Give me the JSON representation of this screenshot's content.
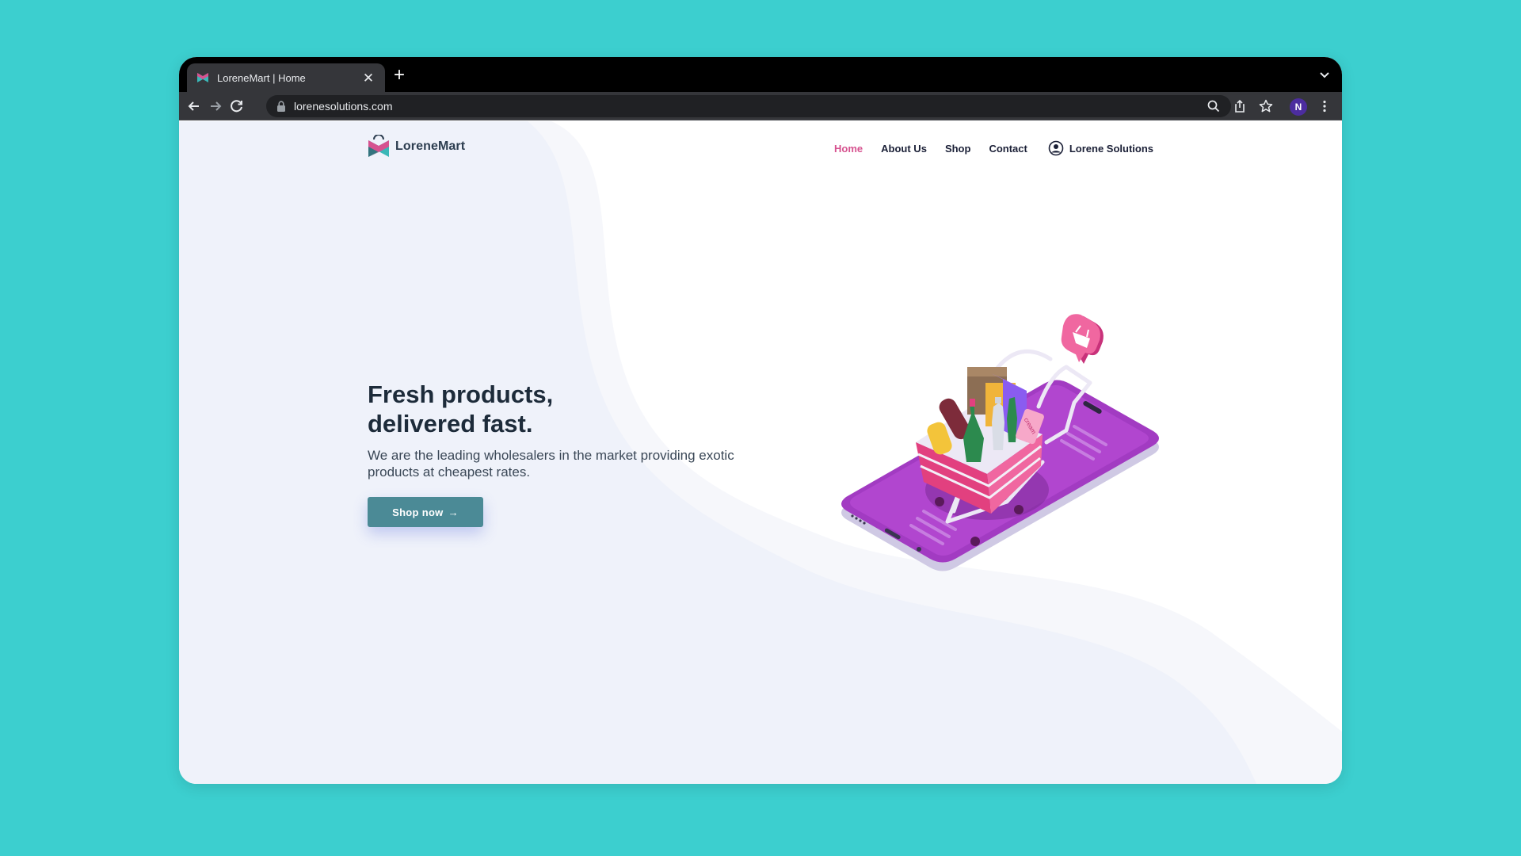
{
  "browser": {
    "tab_title": "LoreneMart | Home",
    "tab_close": "✕",
    "new_tab": "+",
    "url": "lorenesolutions.com",
    "profile_initial": "N",
    "profile_color": "#4c2d9f"
  },
  "site": {
    "logo_text": "LoreneMart",
    "nav": {
      "home": "Home",
      "about": "About Us",
      "shop": "Shop",
      "contact": "Contact",
      "account": "Lorene Solutions"
    },
    "active_nav": "home",
    "accent_color": "#d6528f"
  },
  "hero": {
    "title_line1": "Fresh products,",
    "title_line2": "delivered fast.",
    "subtitle": "We are the leading wholesalers in the market providing exotic products at cheapest rates.",
    "cta_label": "Shop now",
    "cta_arrow": "→",
    "cta_color": "#4b8a96"
  },
  "illustration": {
    "cart_tag_text": "cream"
  },
  "icons": [
    "back-icon",
    "forward-icon",
    "reload-icon",
    "lock-icon",
    "zoom-icon",
    "share-icon",
    "star-icon",
    "more-icon",
    "account-icon",
    "basket-icon"
  ]
}
